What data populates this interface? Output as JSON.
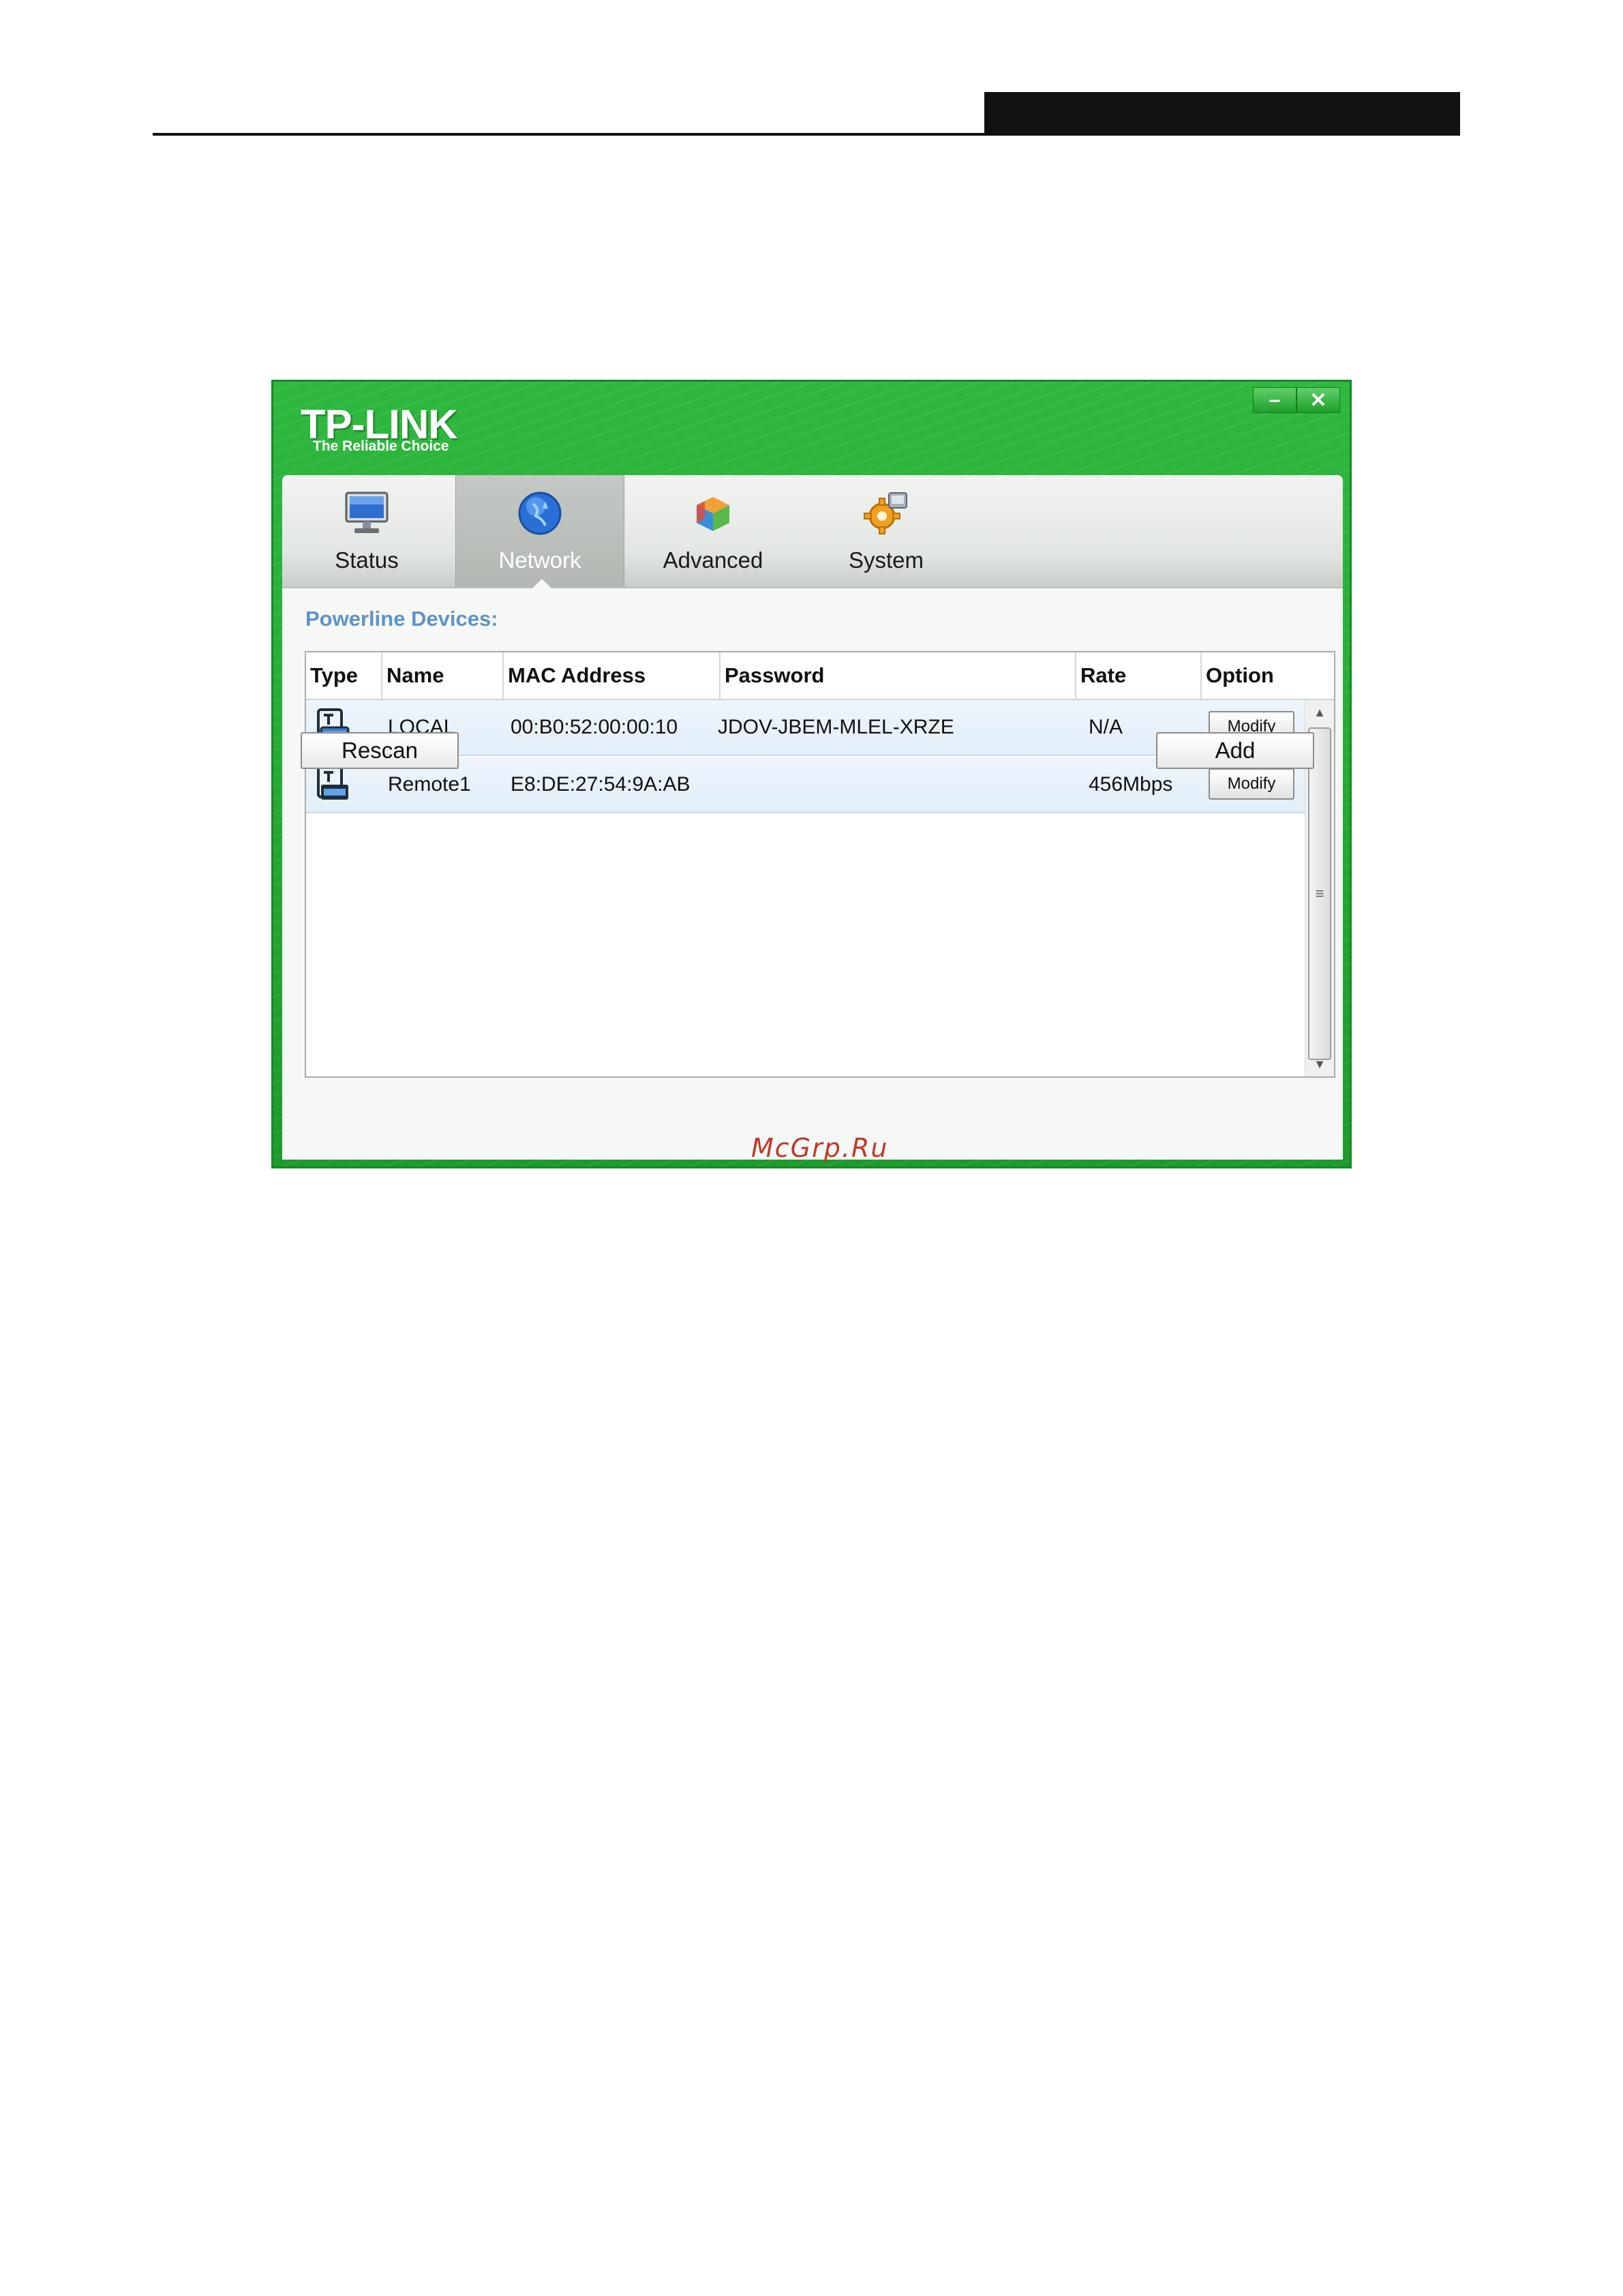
{
  "app": {
    "brand": "TP-LINK",
    "tagline": "The Reliable Choice",
    "minimize_label": "–",
    "close_label": "✕"
  },
  "tabs": [
    {
      "label": "Status",
      "icon": "monitor-icon",
      "active": false
    },
    {
      "label": "Network",
      "icon": "globe-icon",
      "active": true
    },
    {
      "label": "Advanced",
      "icon": "cube-icon",
      "active": false
    },
    {
      "label": "System",
      "icon": "gear-icon",
      "active": false
    }
  ],
  "section_title": "Powerline Devices:",
  "table": {
    "columns": [
      "Type",
      "Name",
      "MAC Address",
      "Password",
      "Rate",
      "Option"
    ],
    "rows": [
      {
        "type_icon": "powerline-adapter-icon",
        "name": "LOCAL",
        "mac": "00:B0:52:00:00:10",
        "password": "JDOV-JBEM-MLEL-XRZE",
        "rate": "N/A",
        "option": "Modify"
      },
      {
        "type_icon": "powerline-adapter-icon",
        "name": "Remote1",
        "mac": "E8:DE:27:54:9A:AB",
        "password": "",
        "rate": "456Mbps",
        "option": "Modify"
      }
    ]
  },
  "scrollbar": {
    "up": "▲",
    "down": "▼",
    "grip": "≡"
  },
  "buttons": {
    "rescan": "Rescan",
    "add": "Add"
  },
  "watermark": "McGrp.Ru",
  "colors": {
    "brand_green": "#23a632",
    "section_title": "#5f93c8",
    "row_bg": "#e8f1fa"
  }
}
